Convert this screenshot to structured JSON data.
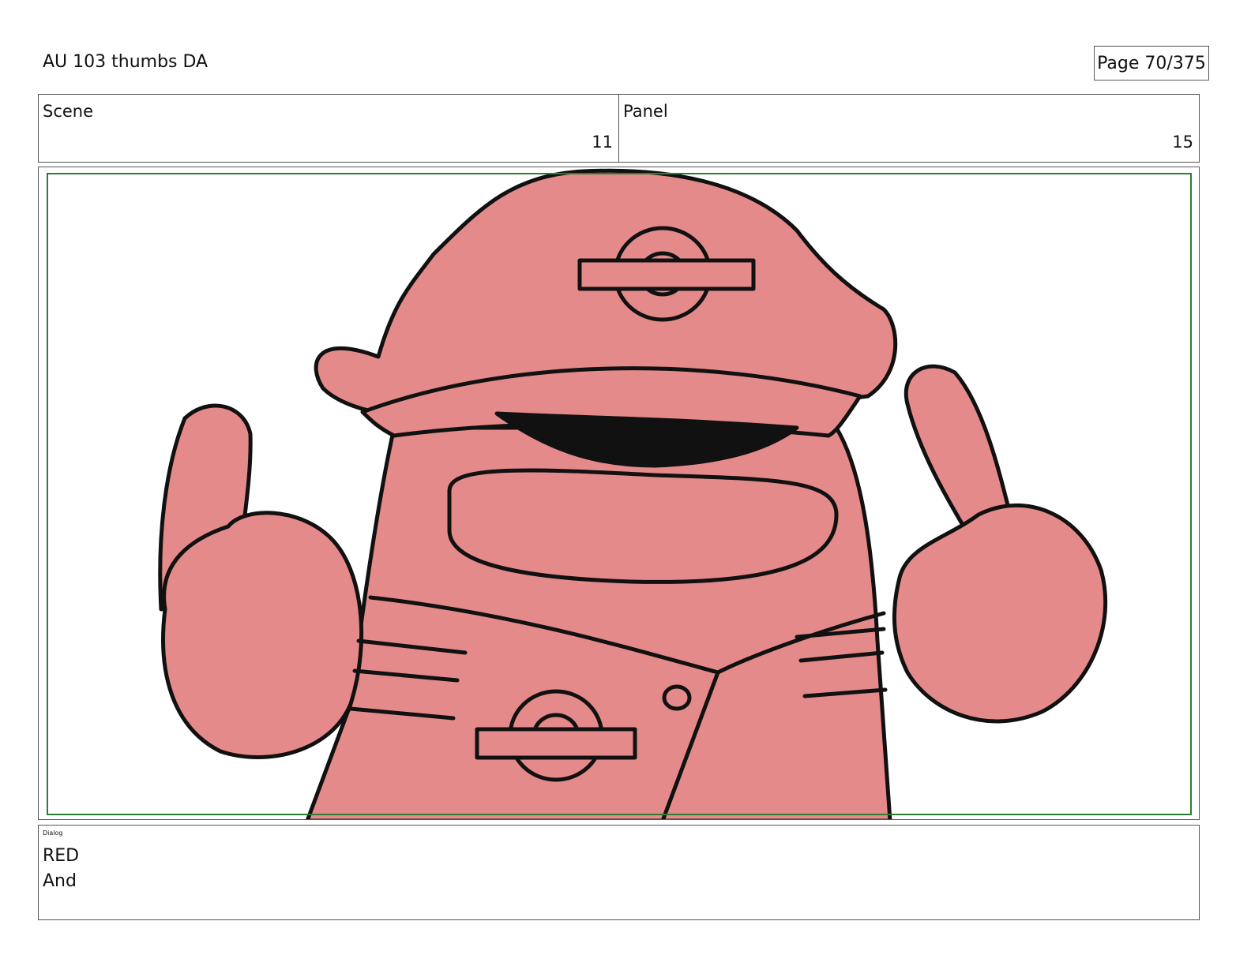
{
  "header": {
    "title": "AU 103 thumbs DA",
    "page_label": "Page",
    "page_value": "70/375"
  },
  "info": {
    "scene_label": "Scene",
    "scene_value": "11",
    "panel_label": "Panel",
    "panel_value": "15"
  },
  "illustration": {
    "subject": "red-character-pointing-up",
    "fill_color": "#e58a8a",
    "line_color": "#111111",
    "frame_color": "#2e7d32"
  },
  "dialog": {
    "label": "Dialog",
    "lines": [
      "RED",
      "And"
    ]
  }
}
